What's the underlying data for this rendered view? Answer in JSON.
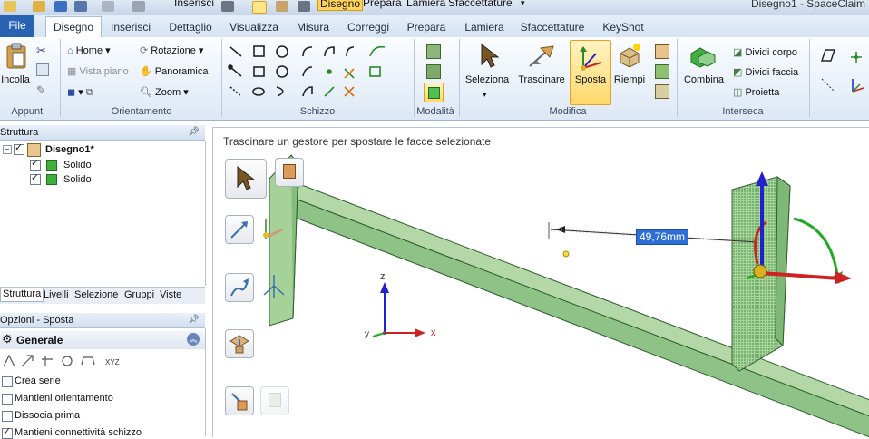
{
  "quick_access": {
    "inserisci": "Inserisci",
    "tabs_tail": [
      "Disegno",
      "Prepara",
      "Lamiera",
      "Sfaccettature"
    ]
  },
  "doc_title": "Disegno1 - SpaceClaim",
  "tabs": [
    "File",
    "Disegno",
    "Inserisci",
    "Dettaglio",
    "Visualizza",
    "Misura",
    "Correggi",
    "Prepara",
    "Lamiera",
    "Sfaccettature",
    "KeyShot"
  ],
  "ribbon": {
    "appunti": {
      "label": "Appunti",
      "incolla": "Incolla"
    },
    "orientamento": {
      "label": "Orientamento",
      "home": "Home",
      "vista_piano": "Vista piano",
      "rotazione": "Rotazione",
      "panoramica": "Panoramica",
      "zoom": "Zoom"
    },
    "schizzo": {
      "label": "Schizzo"
    },
    "modalita": {
      "label": "Modalità"
    },
    "modifica": {
      "label": "Modifica",
      "seleziona": "Seleziona",
      "trascinare": "Trascinare",
      "sposta": "Sposta",
      "riempi": "Riempi"
    },
    "interseca": {
      "label": "Interseca",
      "combina": "Combina",
      "dividi_corpo": "Dividi corpo",
      "dividi_faccia": "Dividi faccia",
      "proietta": "Proietta"
    }
  },
  "struttura": {
    "title": "Struttura",
    "tree": [
      {
        "label": "Disegno1*",
        "checked": true,
        "level": 0
      },
      {
        "label": "Solido",
        "checked": true,
        "level": 1
      },
      {
        "label": "Solido",
        "checked": true,
        "level": 1
      }
    ],
    "bottom_tabs": [
      "Struttura",
      "Livelli",
      "Selezione",
      "Gruppi",
      "Viste"
    ]
  },
  "opzioni": {
    "title": "Opzioni - Sposta",
    "section": "Generale",
    "options": [
      {
        "label": "Crea serie",
        "checked": false
      },
      {
        "label": "Mantieni orientamento",
        "checked": false
      },
      {
        "label": "Dissocia prima",
        "checked": false
      },
      {
        "label": "Mantieni connettività schizzo",
        "checked": true
      }
    ]
  },
  "viewport": {
    "hint": "Trascinare un gestore per spostare le facce selezionate",
    "dimension": "49,76mm",
    "axes": {
      "z": "z",
      "y": "y",
      "x": "x"
    }
  },
  "colors": {
    "accent": "#2a62b3",
    "solid_green": "#9fcf95",
    "move_handle_blue": "#2222cc",
    "move_handle_red": "#cc2222",
    "move_handle_green": "#22aa22"
  }
}
